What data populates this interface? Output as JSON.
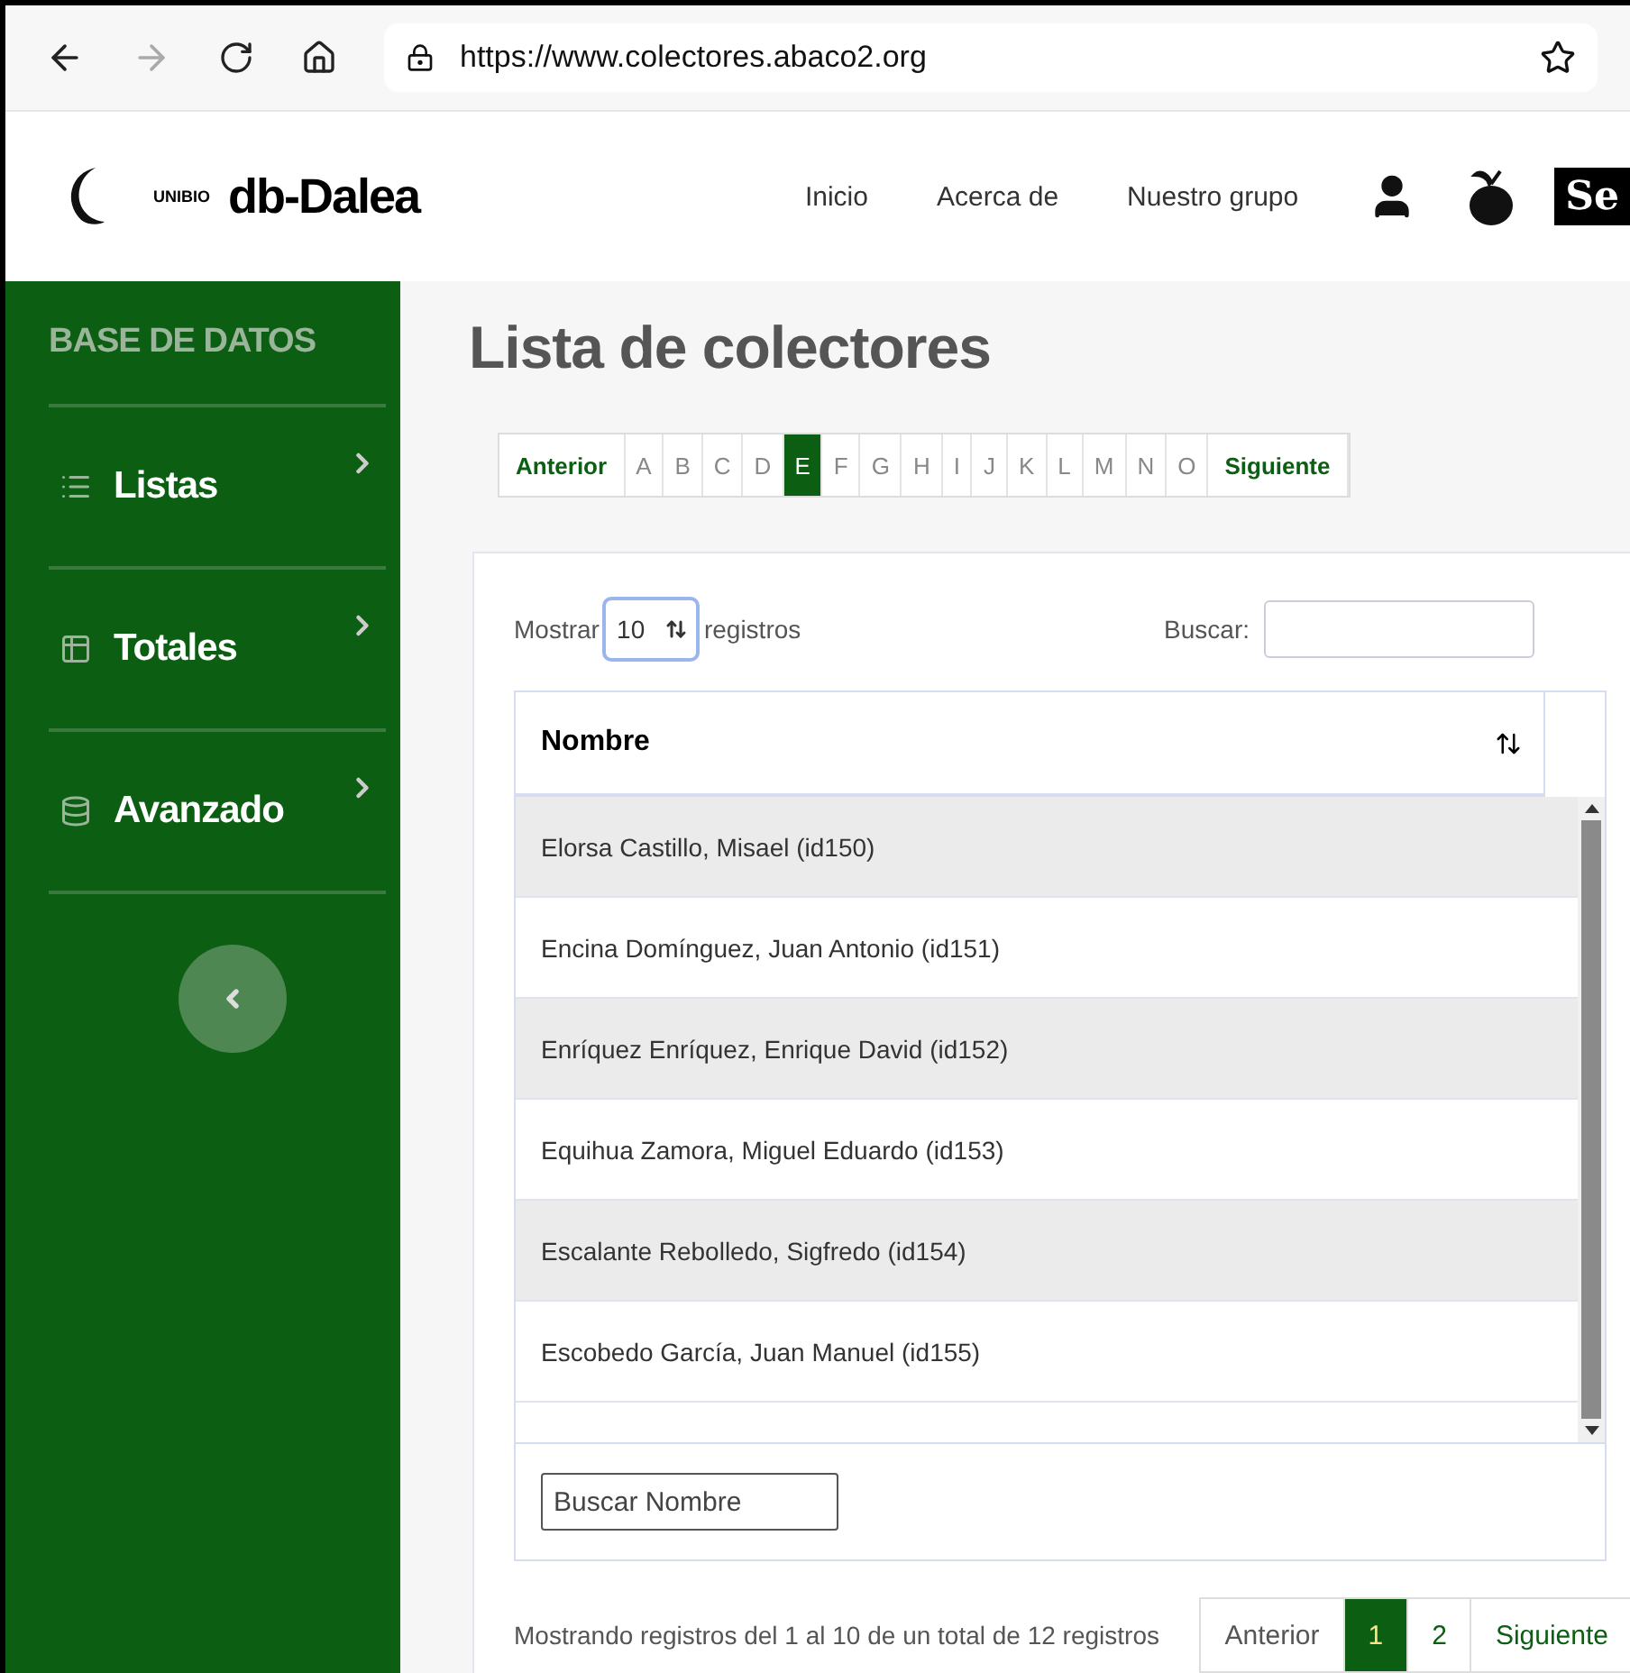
{
  "browser": {
    "url": "https://www.colectores.abaco2.org"
  },
  "header": {
    "logo_text": "UNIBIO",
    "brand": "db-Dalea",
    "nav": [
      "Inicio",
      "Acerca de",
      "Nuestro grupo"
    ],
    "badge_text": "Se"
  },
  "sidebar": {
    "heading": "BASE DE DATOS",
    "items": [
      {
        "label": "Listas",
        "kind": "list"
      },
      {
        "label": "Totales",
        "kind": "table"
      },
      {
        "label": "Avanzado",
        "kind": "database"
      }
    ]
  },
  "title": "Lista de colectores",
  "alphabet": {
    "previous": "Anterior",
    "next": "Siguiente",
    "letters": [
      {
        "label": "A",
        "selected": false
      },
      {
        "label": "B",
        "selected": false
      },
      {
        "label": "C",
        "selected": false
      },
      {
        "label": "D",
        "selected": false
      },
      {
        "label": "E",
        "selected": true
      },
      {
        "label": "F",
        "selected": false
      },
      {
        "label": "G",
        "selected": false
      },
      {
        "label": "H",
        "selected": false
      },
      {
        "label": "I",
        "selected": false
      },
      {
        "label": "J",
        "selected": false
      },
      {
        "label": "K",
        "selected": false
      },
      {
        "label": "L",
        "selected": false
      },
      {
        "label": "M",
        "selected": false
      },
      {
        "label": "N",
        "selected": false
      },
      {
        "label": "O",
        "selected": false
      }
    ]
  },
  "table": {
    "length_before": "Mostrar",
    "length_value": "10",
    "length_after": "registros",
    "search_label": "Buscar:",
    "column": "Nombre",
    "filter_placeholder": "Buscar Nombre",
    "rows": [
      "Elorsa Castillo, Misael (id150)",
      "Encina Domínguez, Juan Antonio (id151)",
      "Enríquez Enríquez, Enrique David (id152)",
      "Equihua Zamora, Miguel Eduardo (id153)",
      "Escalante Rebolledo, Sigfredo (id154)",
      "Escobedo García, Juan Manuel (id155)"
    ],
    "info": "Mostrando registros del 1 al 10 de un total de 12 registros",
    "pagination": {
      "previous": "Anterior",
      "next": "Siguiente",
      "pages": [
        {
          "label": "1",
          "selected": true
        },
        {
          "label": "2",
          "selected": false
        }
      ]
    }
  }
}
